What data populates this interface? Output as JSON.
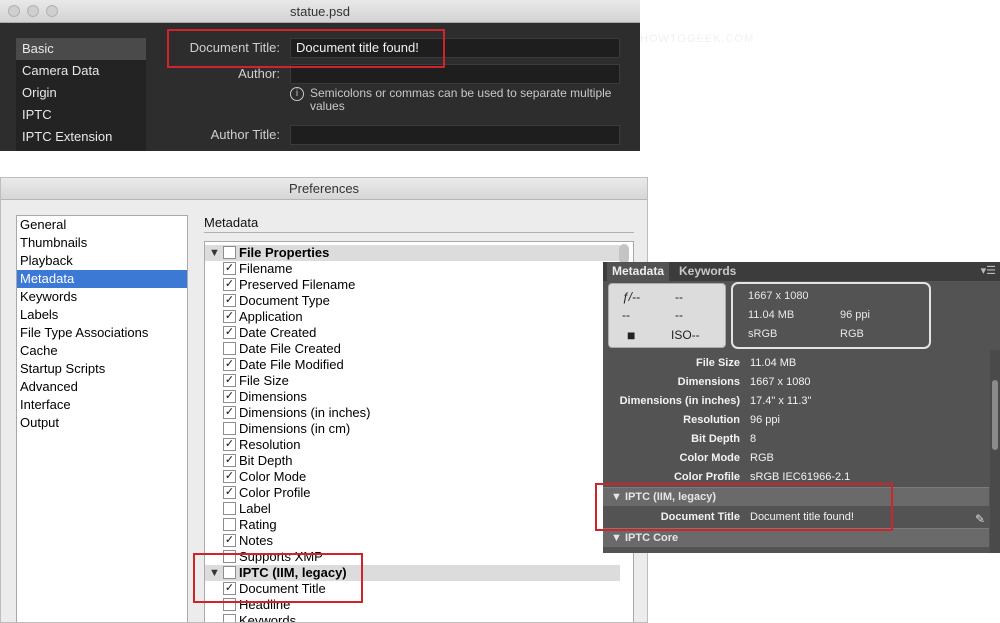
{
  "psd_dialog": {
    "title": "statue.psd",
    "sidebar": [
      "Basic",
      "Camera Data",
      "Origin",
      "IPTC",
      "IPTC Extension"
    ],
    "document_title_label": "Document Title:",
    "document_title_value": "Document title found!",
    "author_label": "Author:",
    "author_value": "",
    "hint": "Semicolons or commas can be used to separate multiple values",
    "author_title_label": "Author Title:",
    "author_title_value": ""
  },
  "watermark": "HOWTOGEEK.COM",
  "preferences": {
    "title": "Preferences",
    "categories": [
      "General",
      "Thumbnails",
      "Playback",
      "Metadata",
      "Keywords",
      "Labels",
      "File Type Associations",
      "Cache",
      "Startup Scripts",
      "Advanced",
      "Interface",
      "Output"
    ],
    "selected_category": "Metadata",
    "section_title": "Metadata",
    "rows": [
      {
        "label": "File Properties",
        "type": "group",
        "checked": false
      },
      {
        "label": "Filename",
        "type": "item",
        "checked": true
      },
      {
        "label": "Preserved Filename",
        "type": "item",
        "checked": true
      },
      {
        "label": "Document Type",
        "type": "item",
        "checked": true
      },
      {
        "label": "Application",
        "type": "item",
        "checked": true
      },
      {
        "label": "Date Created",
        "type": "item",
        "checked": true
      },
      {
        "label": "Date File Created",
        "type": "item",
        "checked": false
      },
      {
        "label": "Date File Modified",
        "type": "item",
        "checked": true
      },
      {
        "label": "File Size",
        "type": "item",
        "checked": true
      },
      {
        "label": "Dimensions",
        "type": "item",
        "checked": true
      },
      {
        "label": "Dimensions (in inches)",
        "type": "item",
        "checked": true
      },
      {
        "label": "Dimensions (in cm)",
        "type": "item",
        "checked": false
      },
      {
        "label": "Resolution",
        "type": "item",
        "checked": true
      },
      {
        "label": "Bit Depth",
        "type": "item",
        "checked": true
      },
      {
        "label": "Color Mode",
        "type": "item",
        "checked": true
      },
      {
        "label": "Color Profile",
        "type": "item",
        "checked": true
      },
      {
        "label": "Label",
        "type": "item",
        "checked": false
      },
      {
        "label": "Rating",
        "type": "item",
        "checked": false
      },
      {
        "label": "Notes",
        "type": "item",
        "checked": true
      },
      {
        "label": "Supports XMP",
        "type": "item",
        "checked": false
      },
      {
        "label": "IPTC (IIM, legacy)",
        "type": "group",
        "checked": false
      },
      {
        "label": "Document Title",
        "type": "item",
        "checked": true
      },
      {
        "label": "Headline",
        "type": "item",
        "checked": false
      },
      {
        "label": "Keywords",
        "type": "item",
        "checked": false
      }
    ]
  },
  "metadata_panel": {
    "tabs": [
      "Metadata",
      "Keywords"
    ],
    "camera": {
      "aperture": "ƒ/--",
      "shutter": "--",
      "row2_left": "--",
      "row2_right": "--",
      "iso": "ISO--"
    },
    "summary": {
      "dimensions": "1667 x 1080",
      "size": "11.04 MB",
      "resolution": "96 ppi",
      "profile": "sRGB",
      "mode": "RGB"
    },
    "properties": [
      {
        "key": "File Size",
        "value": "11.04 MB"
      },
      {
        "key": "Dimensions",
        "value": "1667 x 1080"
      },
      {
        "key": "Dimensions (in inches)",
        "value": "17.4\" x 11.3\""
      },
      {
        "key": "Resolution",
        "value": "96 ppi"
      },
      {
        "key": "Bit Depth",
        "value": "8"
      },
      {
        "key": "Color Mode",
        "value": "RGB"
      },
      {
        "key": "Color Profile",
        "value": "sRGB IEC61966-2.1"
      }
    ],
    "iptc_legacy_label": "IPTC (IIM, legacy)",
    "document_title_key": "Document Title",
    "document_title_value": "Document title found!",
    "iptc_core_label": "IPTC Core"
  }
}
